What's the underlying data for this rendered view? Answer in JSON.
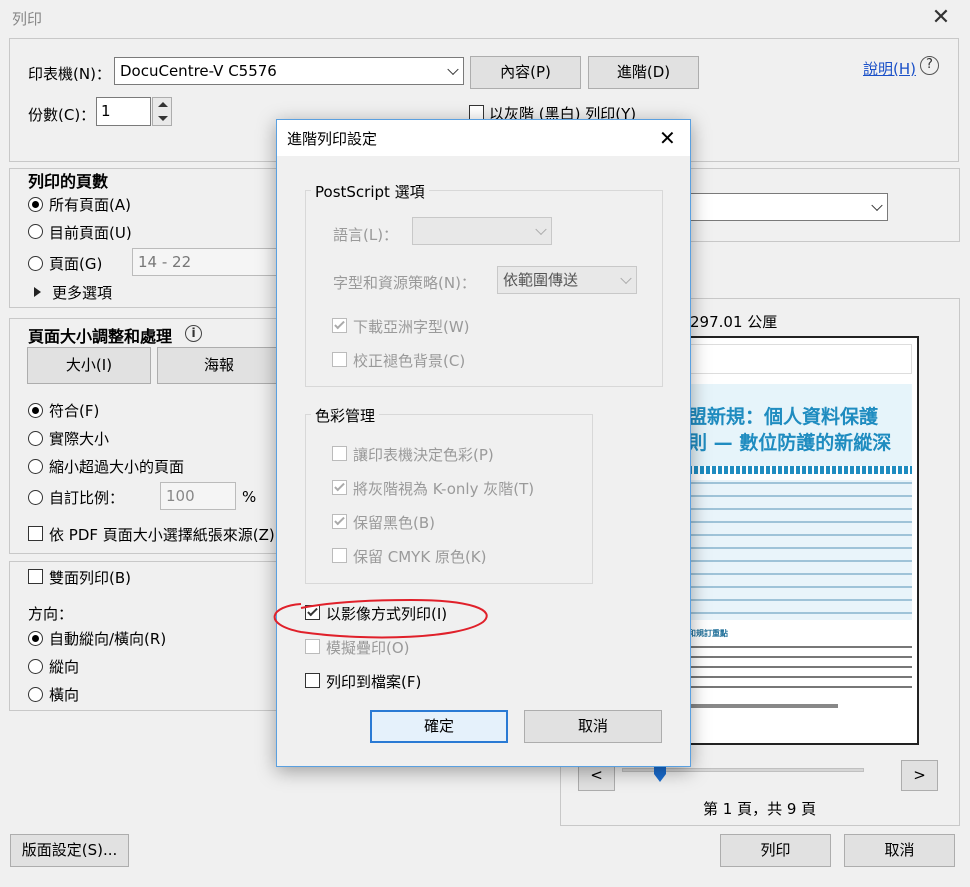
{
  "window": {
    "title": "列印",
    "close_glyph": "✕"
  },
  "printer": {
    "label": "印表機(N)：",
    "value": "DocuCentre-V C5576",
    "properties_btn": "內容(P)",
    "advanced_btn": "進階(D)",
    "help_link": "說明(H)",
    "help_icon": "?"
  },
  "copies": {
    "label": "份數(C)：",
    "value": "1"
  },
  "grayscale": {
    "label": "以灰階 (黑白) 列印(Y)"
  },
  "pages": {
    "title": "列印的頁數",
    "all": "所有頁面(A)",
    "current": "目前頁面(U)",
    "pages_label": "頁面(G)",
    "pages_value": "14 - 22",
    "more": "更多選項"
  },
  "sizing": {
    "title": "頁面大小調整和處理",
    "info_icon": "i",
    "size_btn": "大小(I)",
    "poster_btn": "海報",
    "fit": "符合(F)",
    "actual": "實際大小",
    "shrink": "縮小超過大小的頁面",
    "custom": "自訂比例：",
    "custom_value": "100",
    "percent": "%",
    "pdf_source": "依 PDF 頁面大小選擇紙張來源(Z)"
  },
  "duplex": {
    "label": "雙面列印(B)"
  },
  "orientation": {
    "title": "方向：",
    "auto": "自動縱向/橫向(R)",
    "portrait": "縱向",
    "landscape": "橫向"
  },
  "preview": {
    "size_text": "297.01 公厘",
    "prev": "<",
    "next": ">",
    "page_info": "第 1 頁，共 9 頁",
    "doc_title_line1": "盟新規：個人資料保護",
    "doc_title_line2": "則 — 數位防護的新縱深",
    "doc_section": "和規訂重點"
  },
  "bottom": {
    "page_setup": "版面設定(S)...",
    "print": "列印",
    "cancel": "取消"
  },
  "dialog": {
    "title": "進階列印設定",
    "close_glyph": "✕",
    "postscript_group": "PostScript 選項",
    "language_label": "語言(L)：",
    "language_value": "",
    "font_policy_label": "字型和資源策略(N)：",
    "font_policy_value": "依範圍傳送",
    "download_asian_fonts": "下載亞洲字型(W)",
    "correct_bg": "校正褪色背景(C)",
    "color_group": "色彩管理",
    "printer_color": "讓印表機決定色彩(P)",
    "gray_k_only": "將灰階視為 K-only 灰階(T)",
    "keep_black": "保留黑色(B)",
    "keep_cmyk": "保留 CMYK 原色(K)",
    "print_as_image": "以影像方式列印(I)",
    "simulate_overprint": "模擬疊印(O)",
    "print_to_file": "列印到檔案(F)",
    "ok": "確定",
    "cancel": "取消"
  },
  "colors": {
    "accent": "#2a7ad4",
    "annotation": "#e0202a",
    "doc_title": "#1f8cc0"
  }
}
